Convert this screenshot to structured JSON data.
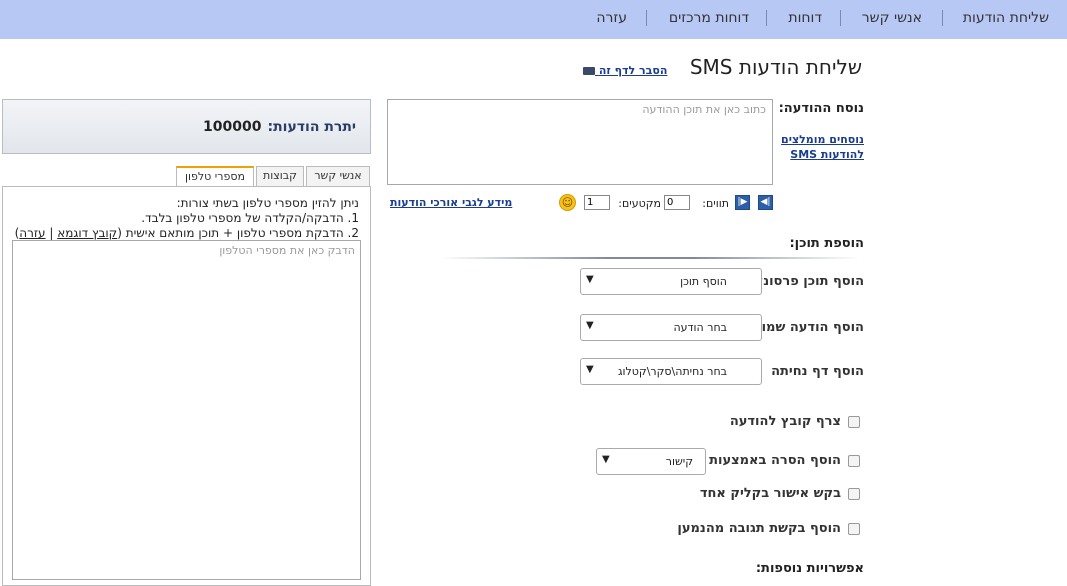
{
  "nav": {
    "items": [
      "שליחת הודעות",
      "אנשי קשר",
      "דוחות",
      "דוחות מרכזים",
      "עזרה"
    ]
  },
  "header": {
    "title": "שליחת הודעות SMS",
    "explain_link": "הסבר לדף זה"
  },
  "message": {
    "label": "נוסח ההודעה:",
    "placeholder": "כתוב כאן את תוכן ההודעה",
    "recommended_link": "נוסחים מומלצים להודעות SMS"
  },
  "counter": {
    "chars_label": "תווים:",
    "chars_value": "0",
    "segments_label": "מקטעים:",
    "segments_value": "1",
    "long_msg_link": "מידע לגבי אורכי הודעות"
  },
  "add_content": {
    "title": "הוספת תוכן:",
    "rows": [
      {
        "label": "הוסף תוכן פרסונלי",
        "value": "הוסף תוכן"
      },
      {
        "label": "הוסף הודעה שמורה",
        "value": "בחר הודעה"
      },
      {
        "label": "הוסף דף נחיתה",
        "value": "בחר נחיתה\\סקר\\קטלוג"
      }
    ]
  },
  "options": {
    "attach_file": "צרף קובץ להודעה",
    "remove_via": "הוסף הסרה באמצעות",
    "remove_via_value": "קישור",
    "one_click": "בקש אישור בקליק אחד",
    "reply_request": "הוסף בקשת תגובה מהנמען"
  },
  "more_options": {
    "title": "אפשרויות נוספות:"
  },
  "balance": {
    "label": "יתרת הודעות:",
    "value": "100000"
  },
  "tabs": [
    "מספרי טלפון",
    "קבוצות",
    "אנשי קשר"
  ],
  "phones": {
    "line1": "ניתן להזין מספרי טלפון בשתי צורות:",
    "line2": "1. הדבקה/הקלדה של מספרי טלפון בלבד.",
    "line3": "2. הדבקת מספרי טלפון + תוכן מותאם אישית",
    "sample_link": "קובץ דוגמא",
    "help_link": "עזרה",
    "placeholder": "הדבק כאן את מספרי הטלפון"
  },
  "colors": {
    "nav_bg": "#b8c8f5",
    "link": "#1a3d8f",
    "tab_accent": "#f0a000",
    "counter_btn": "#2d5fa8"
  }
}
